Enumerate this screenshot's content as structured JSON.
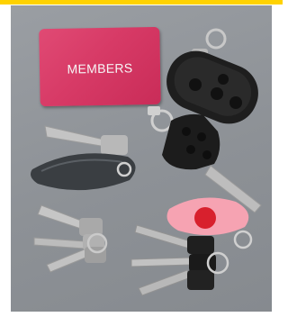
{
  "card": {
    "text": "MEMBERS"
  },
  "colors": {
    "background": "#8f9398",
    "card": "#d73a66",
    "top_bar": "#ffd200",
    "pink_fob": "#f6a3b2",
    "red_dot": "#d8202d"
  }
}
